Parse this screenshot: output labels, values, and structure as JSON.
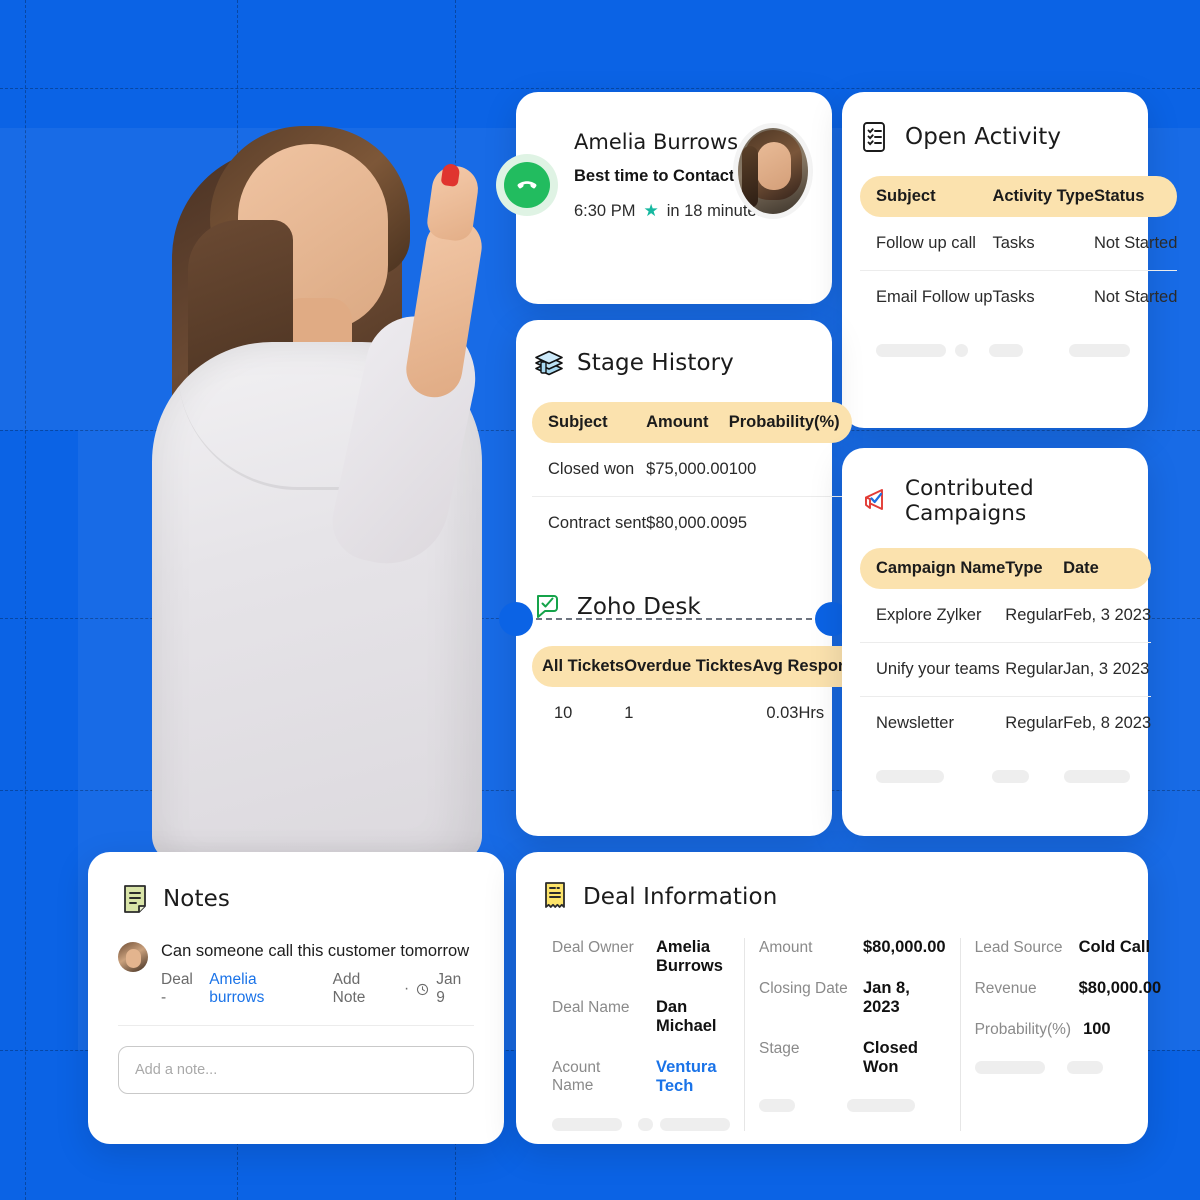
{
  "theme": {
    "background": "#0b63e5",
    "card_bg": "#ffffff",
    "table_header_bg": "#fbe2ae",
    "link_color": "#1a73e8",
    "call_green": "#22bc5f",
    "star_teal": "#16b8a0"
  },
  "contact_card": {
    "name": "Amelia Burrows",
    "best_time": "Best time to Contact - Today",
    "time": "6:30 PM",
    "countdown": "in 18 minutes",
    "call_icon": "phone-icon",
    "star_icon": "star-icon",
    "avatar_name": "contact-avatar"
  },
  "open_activity": {
    "title": "Open Activity",
    "icon": "checklist-icon",
    "columns": [
      "Subject",
      "Activity Type",
      "Status"
    ],
    "rows": [
      [
        "Follow up call",
        "Tasks",
        "Not Started"
      ],
      [
        "Email Follow up",
        "Tasks",
        "Not Started"
      ]
    ]
  },
  "stage_history": {
    "title": "Stage History",
    "icon": "stacked-books-icon",
    "columns": [
      "Subject",
      "Amount",
      "Probability(%)"
    ],
    "rows": [
      [
        "Closed won",
        "$75,000.00",
        "100"
      ],
      [
        "Contract sent",
        "$80,000.00",
        "95"
      ]
    ]
  },
  "zoho_desk": {
    "title": "Zoho Desk",
    "icon": "desk-chat-icon",
    "columns": [
      "All Tickets",
      "Overdue Ticktes",
      "Avg Response Time"
    ],
    "rows": [
      [
        "10",
        "1",
        "0.03Hrs"
      ]
    ]
  },
  "contributed_campaigns": {
    "title": "Contributed Campaigns",
    "icon": "megaphone-icon",
    "columns": [
      "Campaign Name",
      "Type",
      "Date"
    ],
    "rows": [
      [
        "Explore Zylker",
        "Regular",
        "Feb, 3 2023"
      ],
      [
        "Unify your teams",
        "Regular",
        "Jan, 3 2023"
      ],
      [
        "Newsletter",
        "Regular",
        "Feb, 8 2023"
      ]
    ]
  },
  "notes": {
    "title": "Notes",
    "icon": "note-page-icon",
    "entry_text": "Can someone call this customer tomorrow",
    "meta_prefix": "Deal -",
    "meta_link": "Amelia burrows",
    "meta_action": "Add Note",
    "meta_dot": "·",
    "meta_clock_icon": "clock-icon",
    "meta_date": "Jan 9",
    "input_placeholder": "Add a note...",
    "input_value": ""
  },
  "deal_information": {
    "title": "Deal Information",
    "icon": "receipt-icon",
    "columns": [
      [
        {
          "label": "Deal Owner",
          "value": "Amelia Burrows",
          "link": false
        },
        {
          "label": "Deal Name",
          "value": "Dan Michael",
          "link": false
        },
        {
          "label": "Acount Name",
          "value": "Ventura Tech",
          "link": true
        }
      ],
      [
        {
          "label": "Amount",
          "value": "$80,000.00",
          "link": false
        },
        {
          "label": "Closing Date",
          "value": "Jan 8, 2023",
          "link": false
        },
        {
          "label": "Stage",
          "value": "Closed Won",
          "link": false
        }
      ],
      [
        {
          "label": "Lead Source",
          "value": "Cold Call",
          "link": false
        },
        {
          "label": "Revenue",
          "value": "$80,000.00",
          "link": false
        },
        {
          "label": "Probability(%)",
          "value": "100",
          "link": false
        }
      ]
    ]
  }
}
